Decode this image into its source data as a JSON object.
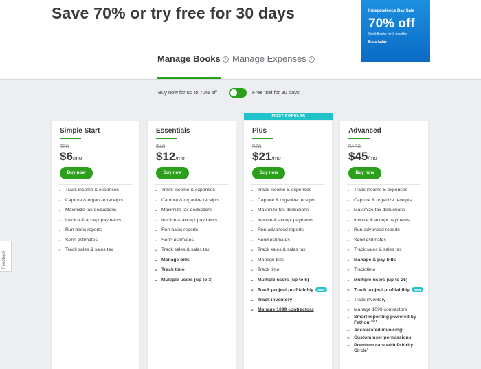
{
  "headline": "Save 70% or try free for 30 days",
  "promo": {
    "title": "Independence Day Sale",
    "big": "70% off",
    "sub": "QuickBooks for 3 months",
    "end": "Ends today",
    "color": "#0a6bc5"
  },
  "tabs": [
    {
      "label": "Manage Books",
      "active": true
    },
    {
      "label": "Manage Expenses",
      "active": false
    }
  ],
  "toggle": {
    "left_label": "Buy now for up to 70% off",
    "right_label": "Free trial for 30 days"
  },
  "feedback_label": "Feedback",
  "popular_label": "MOST POPULAR",
  "accent_color": "#2ca01c",
  "plans": [
    {
      "name": "Simple Start",
      "was": "$20",
      "price": "$6",
      "per": "/mo",
      "buy": "Buy now",
      "features": [
        "Track income & expenses",
        "Capture & organize receipts",
        "Maximize tax deductions",
        "Invoice & accept payments",
        "Run basic reports",
        "Send estimates",
        "Track sales & sales tax"
      ]
    },
    {
      "name": "Essentials",
      "was": "$40",
      "price": "$12",
      "per": "/mo",
      "buy": "Buy now",
      "features": [
        "Track income & expenses",
        "Capture & organize receipts",
        "Maximize tax deductions",
        "Invoice & accept payments",
        "Run basic reports",
        "Send estimates",
        "Track sales & sales tax",
        "Manage bills",
        "Track time",
        "Multiple users (up to 3)"
      ]
    },
    {
      "name": "Plus",
      "was": "$70",
      "price": "$21",
      "per": "/mo",
      "buy": "Buy now",
      "features": [
        "Track income & expenses",
        "Capture & organize receipts",
        "Maximize tax deductions",
        "Invoice & accept payments",
        "Run advanced reports",
        "Send estimates",
        "Track sales & sales tax",
        "Manage bills",
        "Track time",
        "Multiple users (up to 5)",
        "Track project profitability",
        "Track inventory",
        "Manage 1099 contractors"
      ]
    },
    {
      "name": "Advanced",
      "was": "$150",
      "price": "$45",
      "per": "/mo",
      "buy": "Buy now",
      "features": [
        "Track income & expenses",
        "Capture & organize receipts",
        "Maximize tax deductions",
        "Invoice & accept payments",
        "Run advanced reports",
        "Send estimates",
        "Track sales & sales tax",
        "Manage & pay bills",
        "Track time",
        "Multiple users (up to 25)",
        "Track project profitability",
        "Track inventory",
        "Manage 1099 contractors",
        "Smart reporting powered by Fathom™¹",
        "Accelerated invoicing²",
        "Custom user permissions",
        "Premium care with Priority Circle²"
      ]
    }
  ],
  "new_badge": "NEW"
}
